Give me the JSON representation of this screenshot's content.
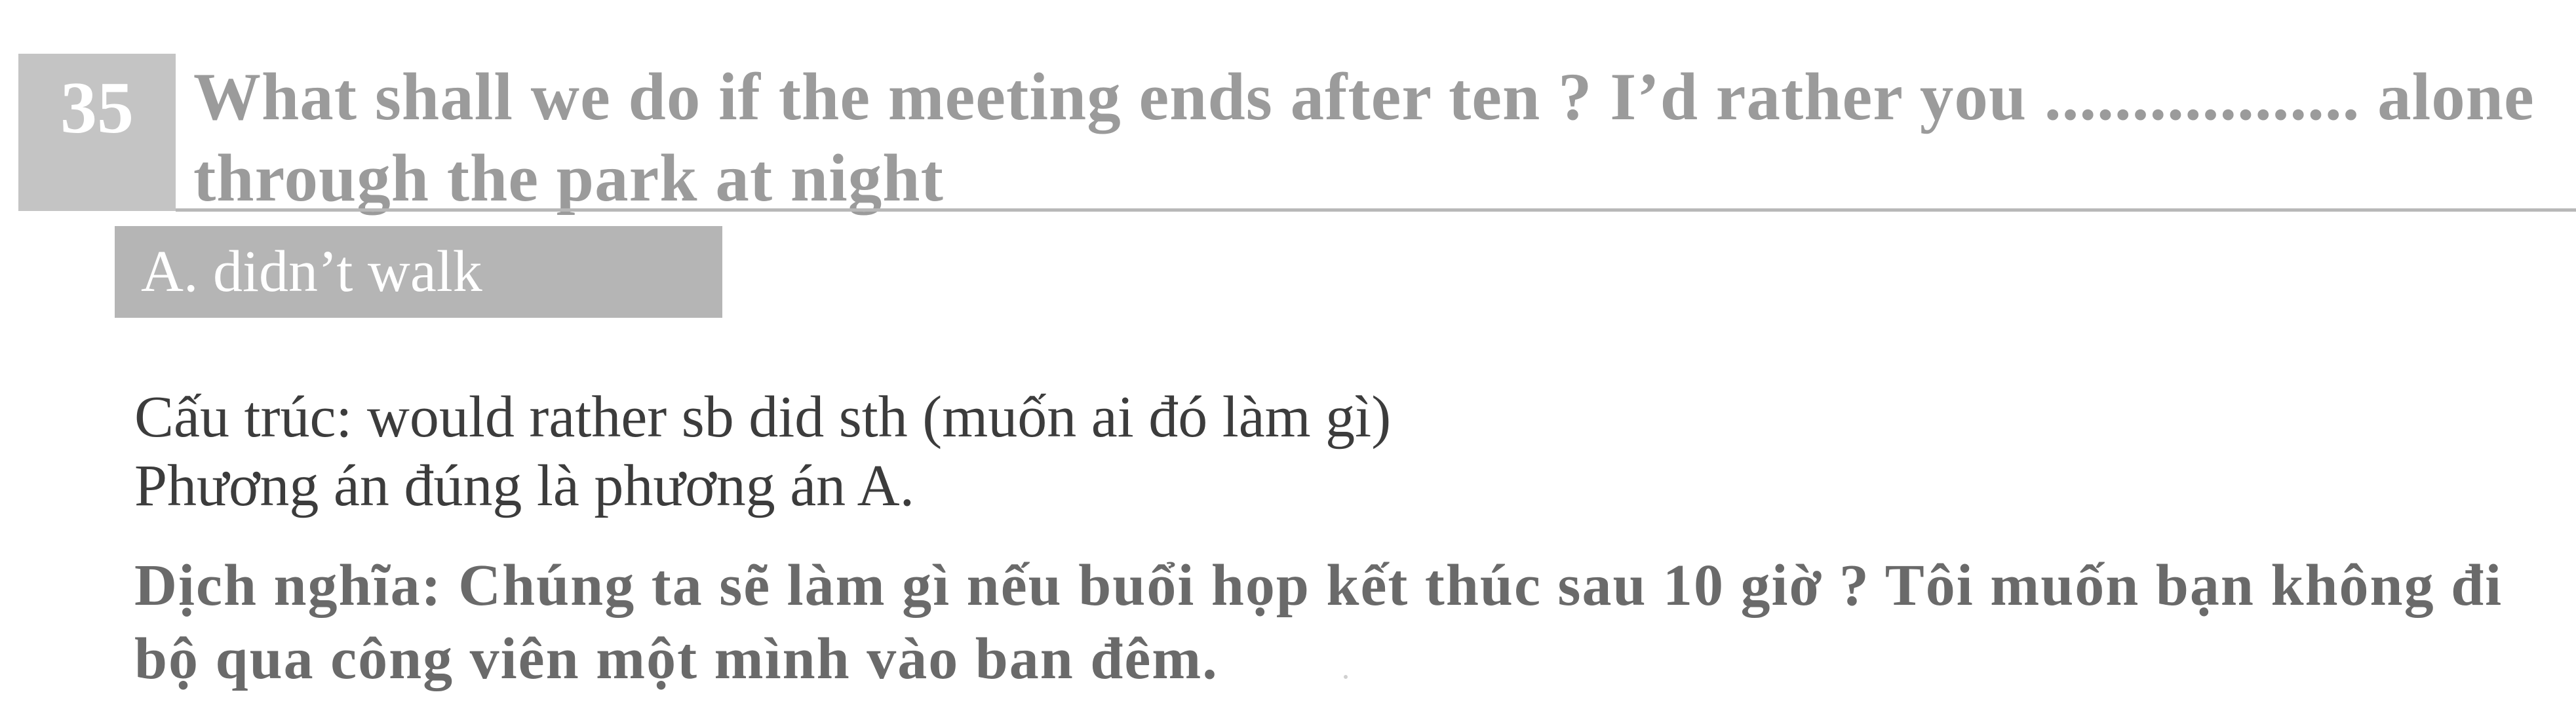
{
  "question": {
    "number": "35",
    "text": "What shall we do if the meeting ends after ten ? I’d rather you .................. alone through the park at night"
  },
  "answer": {
    "label": "A. didn’t walk"
  },
  "explanation": {
    "structure": "Cấu trúc: would rather sb did sth (muốn ai đó làm gì)",
    "correct": "Phương án đúng là phương án A."
  },
  "translation": {
    "text": "Dịch nghĩa: Chúng ta sẽ làm gì nếu buổi họp kết thúc sau 10 giờ ? Tôi muốn bạn không đi bộ qua công viên một mình vào ban đêm."
  },
  "colors": {
    "number_block": "#c4c4c4",
    "question_text": "#9b9b9b",
    "answer_box": "#b5b5b5",
    "body_text": "#3c3c3c",
    "translation_text": "#6a6a6a"
  }
}
